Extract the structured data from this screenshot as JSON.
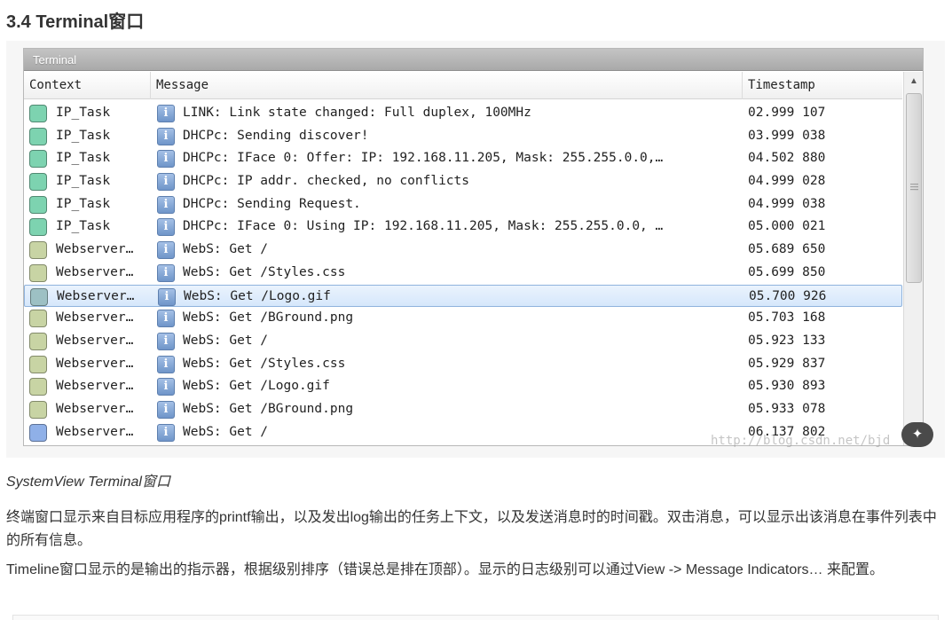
{
  "heading": "3.4 Terminal窗口",
  "terminal": {
    "title": "Terminal",
    "columns": [
      "Context",
      "Message",
      "Timestamp"
    ],
    "rows": [
      {
        "context": "IP_Task",
        "message": "LINK: Link state changed: Full duplex, 100MHz",
        "timestamp": "02.999 107",
        "color": "#7dd3b0"
      },
      {
        "context": "IP_Task",
        "message": "DHCPc: Sending discover!",
        "timestamp": "03.999 038",
        "color": "#7dd3b0"
      },
      {
        "context": "IP_Task",
        "message": "DHCPc: IFace 0: Offer: IP: 192.168.11.205, Mask: 255.255.0.0,…",
        "timestamp": "04.502 880",
        "color": "#7dd3b0"
      },
      {
        "context": "IP_Task",
        "message": "DHCPc: IP addr. checked, no conflicts",
        "timestamp": "04.999 028",
        "color": "#7dd3b0"
      },
      {
        "context": "IP_Task",
        "message": "DHCPc: Sending Request.",
        "timestamp": "04.999 038",
        "color": "#7dd3b0"
      },
      {
        "context": "IP_Task",
        "message": "DHCPc: IFace 0: Using IP: 192.168.11.205, Mask: 255.255.0.0, …",
        "timestamp": "05.000 021",
        "color": "#7dd3b0"
      },
      {
        "context": "Webserver…",
        "message": "WebS: Get /",
        "timestamp": "05.689 650",
        "color": "#c8d4a4"
      },
      {
        "context": "Webserver…",
        "message": "WebS: Get /Styles.css",
        "timestamp": "05.699 850",
        "color": "#c8d4a4"
      },
      {
        "context": "Webserver…",
        "message": "WebS: Get /Logo.gif",
        "timestamp": "05.700 926",
        "color": "#9dc0c4",
        "selected": true
      },
      {
        "context": "Webserver…",
        "message": "WebS: Get /BGround.png",
        "timestamp": "05.703 168",
        "color": "#c8d4a4"
      },
      {
        "context": "Webserver…",
        "message": "WebS: Get /",
        "timestamp": "05.923 133",
        "color": "#c8d4a4"
      },
      {
        "context": "Webserver…",
        "message": "WebS: Get /Styles.css",
        "timestamp": "05.929 837",
        "color": "#c8d4a4"
      },
      {
        "context": "Webserver…",
        "message": "WebS: Get /Logo.gif",
        "timestamp": "05.930 893",
        "color": "#c8d4a4"
      },
      {
        "context": "Webserver…",
        "message": "WebS: Get /BGround.png",
        "timestamp": "05.933 078",
        "color": "#c8d4a4"
      },
      {
        "context": "Webserver…",
        "message": "WebS: Get /",
        "timestamp": "06.137 802",
        "color": "#8fb0e8"
      }
    ],
    "info_icon": "i"
  },
  "watermark": "http://blog.csdn.net/bjd",
  "caption": "SystemView Terminal窗口",
  "paragraphs": [
    "终端窗口显示来自目标应用程序的printf输出，以及发出log输出的任务上下文，以及发送消息时的时间戳。双击消息，可以显示出该消息在事件列表中的所有信息。",
    "Timeline窗口显示的是输出的指示器，根据级别排序（错误总是排在顶部）。显示的日志级别可以通过View -> Message Indicators… 来配置。"
  ]
}
